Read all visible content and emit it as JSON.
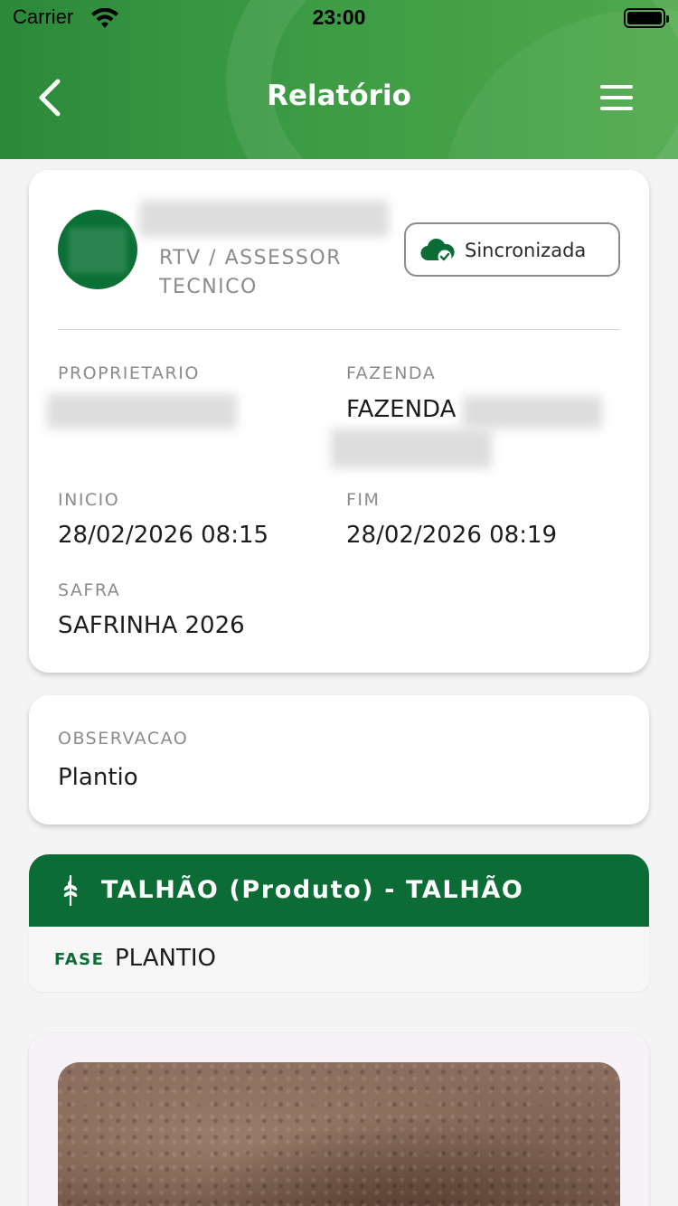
{
  "status_bar": {
    "carrier": "Carrier",
    "time": "23:00"
  },
  "header": {
    "title": "Relatório"
  },
  "user": {
    "role": "RTV / ASSESSOR TECNICO"
  },
  "sync": {
    "label": "Sincronizada"
  },
  "report": {
    "proprietario_label": "PROPRIETARIO",
    "fazenda_label": "FAZENDA",
    "fazenda_value": "FAZENDA",
    "inicio_label": "INICIO",
    "inicio_value": "28/02/2026 08:15",
    "fim_label": "FIM",
    "fim_value": "28/02/2026 08:19",
    "safra_label": "SAFRA",
    "safra_value": "SAFRINHA 2026"
  },
  "observation": {
    "label": "OBSERVACAO",
    "value": "Plantio"
  },
  "talhao": {
    "title": "TALHÃO (Produto) - TALHÃO",
    "fase_label": "FASE",
    "fase_value": "PLANTIO"
  },
  "colors": {
    "brand_green": "#0b6d35",
    "header_green": "#3a9a43"
  },
  "icons": [
    "chevron-left-icon",
    "menu-icon",
    "cloud-check-icon",
    "wheat-icon",
    "wifi-icon",
    "battery-icon"
  ]
}
